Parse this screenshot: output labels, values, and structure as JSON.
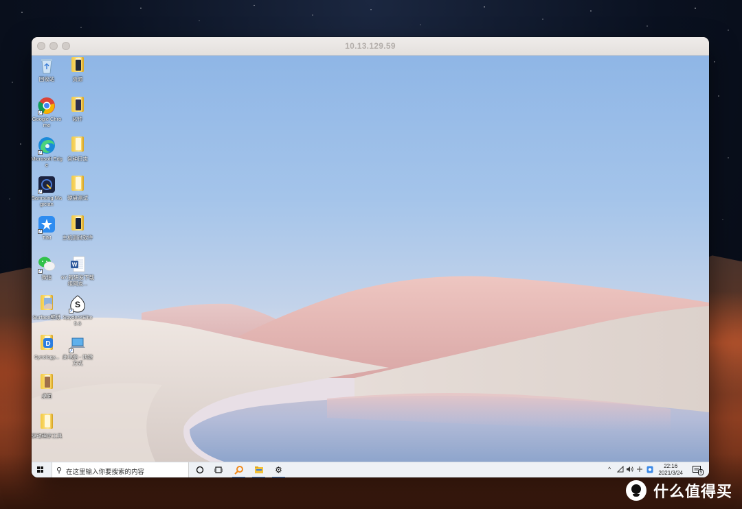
{
  "window": {
    "title": "10.13.129.59"
  },
  "desktop_icons": [
    {
      "name": "recycle-bin-icon",
      "label": "回收站"
    },
    {
      "name": "folder-icon",
      "label": "资源"
    },
    {
      "name": "chrome-icon",
      "label": "Google Chrome"
    },
    {
      "name": "folder-icon",
      "label": "软件"
    },
    {
      "name": "edge-icon",
      "label": "Microsoft Edge"
    },
    {
      "name": "folder-icon",
      "label": "各种日志"
    },
    {
      "name": "samsung-magician-icon",
      "label": "Samsung Magician"
    },
    {
      "name": "folder-icon",
      "label": "硬盘测试"
    },
    {
      "name": "tim-icon",
      "label": "TIM"
    },
    {
      "name": "folder-icon",
      "label": "主机测试软件"
    },
    {
      "name": "wechat-icon",
      "label": "微信"
    },
    {
      "name": "word-doc-icon",
      "label": "67.新研发下载组网友..."
    },
    {
      "name": "surface-folder-icon",
      "label": "Surface壁纸"
    },
    {
      "name": "spyder-icon",
      "label": "SpyderXElite 5.6"
    },
    {
      "name": "synology-icon",
      "label": "Synology..."
    },
    {
      "name": "laptop-icon",
      "label": "此电脑 - 快捷方式"
    },
    {
      "name": "folder-icon",
      "label": "桌面"
    },
    {
      "name": "folder-icon",
      "label": "驱动程序工具"
    }
  ],
  "taskbar": {
    "search_placeholder": "在这里输入你要搜索的内容",
    "time": "22:16",
    "date": "2021/3/24",
    "notification_count": "5",
    "tray_caret": "^"
  },
  "brand": {
    "label": "什么值得买",
    "logo": "值"
  },
  "colors": {
    "sky_top": "#8fb6e6",
    "dunes": "#e0d6d0",
    "pink_trees": "#e8bcb9",
    "water": "#9fb2d4",
    "taskbar": "#eef1f5"
  }
}
